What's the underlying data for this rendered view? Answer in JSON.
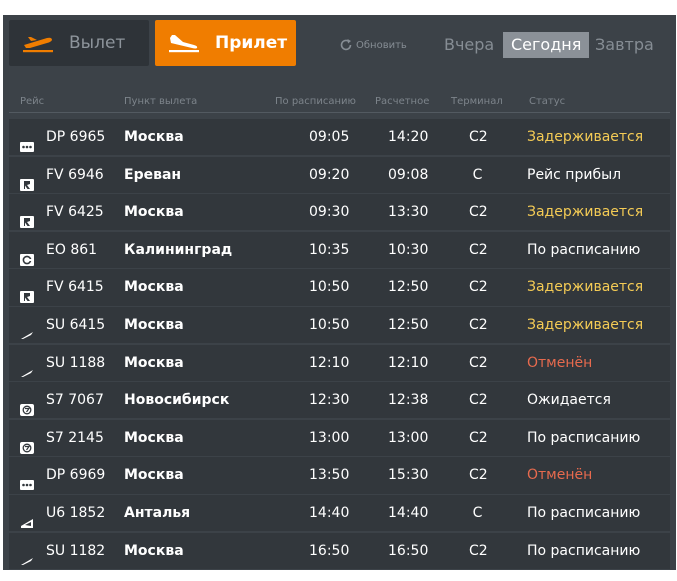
{
  "tabs": {
    "departure_label": "Вылет",
    "arrival_label": "Прилет"
  },
  "refresh_label": "Обновить",
  "days": {
    "yesterday": "Вчера",
    "today": "Сегодня",
    "tomorrow": "Завтра",
    "selected": "today"
  },
  "columns": {
    "flight": "Рейс",
    "origin": "Пункт вылета",
    "scheduled": "По расписанию",
    "estimated": "Расчетное",
    "terminal": "Терминал",
    "status": "Статус"
  },
  "colors": {
    "accent": "#f07d00",
    "delayed": "#f4cb55",
    "cancelled": "#e76a4e",
    "row_bg": "#32373c",
    "board_bg": "#3c4248"
  },
  "flights": [
    {
      "logo": "dots-airline-icon",
      "flight": "DP 6965",
      "city": "Москва",
      "scheduled": "09:05",
      "estimated": "14:20",
      "terminal": "C2",
      "status": "Задерживается",
      "state": "delayed"
    },
    {
      "logo": "r-airline-icon",
      "flight": "FV 6946",
      "city": "Ереван",
      "scheduled": "09:20",
      "estimated": "09:08",
      "terminal": "C",
      "status": "Рейс прибыл",
      "state": "normal"
    },
    {
      "logo": "r-airline-icon",
      "flight": "FV 6425",
      "city": "Москва",
      "scheduled": "09:30",
      "estimated": "13:30",
      "terminal": "C2",
      "status": "Задерживается",
      "state": "delayed"
    },
    {
      "logo": "c-airline-icon",
      "flight": "EO 861",
      "city": "Калининград",
      "scheduled": "10:35",
      "estimated": "10:30",
      "terminal": "C2",
      "status": "По расписанию",
      "state": "normal"
    },
    {
      "logo": "r-airline-icon",
      "flight": "FV 6415",
      "city": "Москва",
      "scheduled": "10:50",
      "estimated": "12:50",
      "terminal": "C2",
      "status": "Задерживается",
      "state": "delayed"
    },
    {
      "logo": "wing-airline-icon",
      "flight": "SU 6415",
      "city": "Москва",
      "scheduled": "10:50",
      "estimated": "12:50",
      "terminal": "C2",
      "status": "Задерживается",
      "state": "delayed"
    },
    {
      "logo": "wing-airline-icon",
      "flight": "SU 1188",
      "city": "Москва",
      "scheduled": "12:10",
      "estimated": "12:10",
      "terminal": "C2",
      "status": "Отменён",
      "state": "cancelled"
    },
    {
      "logo": "s7-airline-icon",
      "flight": "S7 7067",
      "city": "Новосибирск",
      "scheduled": "12:30",
      "estimated": "12:38",
      "terminal": "C2",
      "status": "Ожидается",
      "state": "normal"
    },
    {
      "logo": "s7-airline-icon",
      "flight": "S7 2145",
      "city": "Москва",
      "scheduled": "13:00",
      "estimated": "13:00",
      "terminal": "C2",
      "status": "По расписанию",
      "state": "normal"
    },
    {
      "logo": "dots-airline-icon",
      "flight": "DP 6969",
      "city": "Москва",
      "scheduled": "13:50",
      "estimated": "15:30",
      "terminal": "C2",
      "status": "Отменён",
      "state": "cancelled"
    },
    {
      "logo": "u6-airline-icon",
      "flight": "U6 1852",
      "city": "Анталья",
      "scheduled": "14:40",
      "estimated": "14:40",
      "terminal": "C",
      "status": "По расписанию",
      "state": "normal"
    },
    {
      "logo": "wing-airline-icon",
      "flight": "SU 1182",
      "city": "Москва",
      "scheduled": "16:50",
      "estimated": "16:50",
      "terminal": "C2",
      "status": "По расписанию",
      "state": "normal"
    }
  ]
}
